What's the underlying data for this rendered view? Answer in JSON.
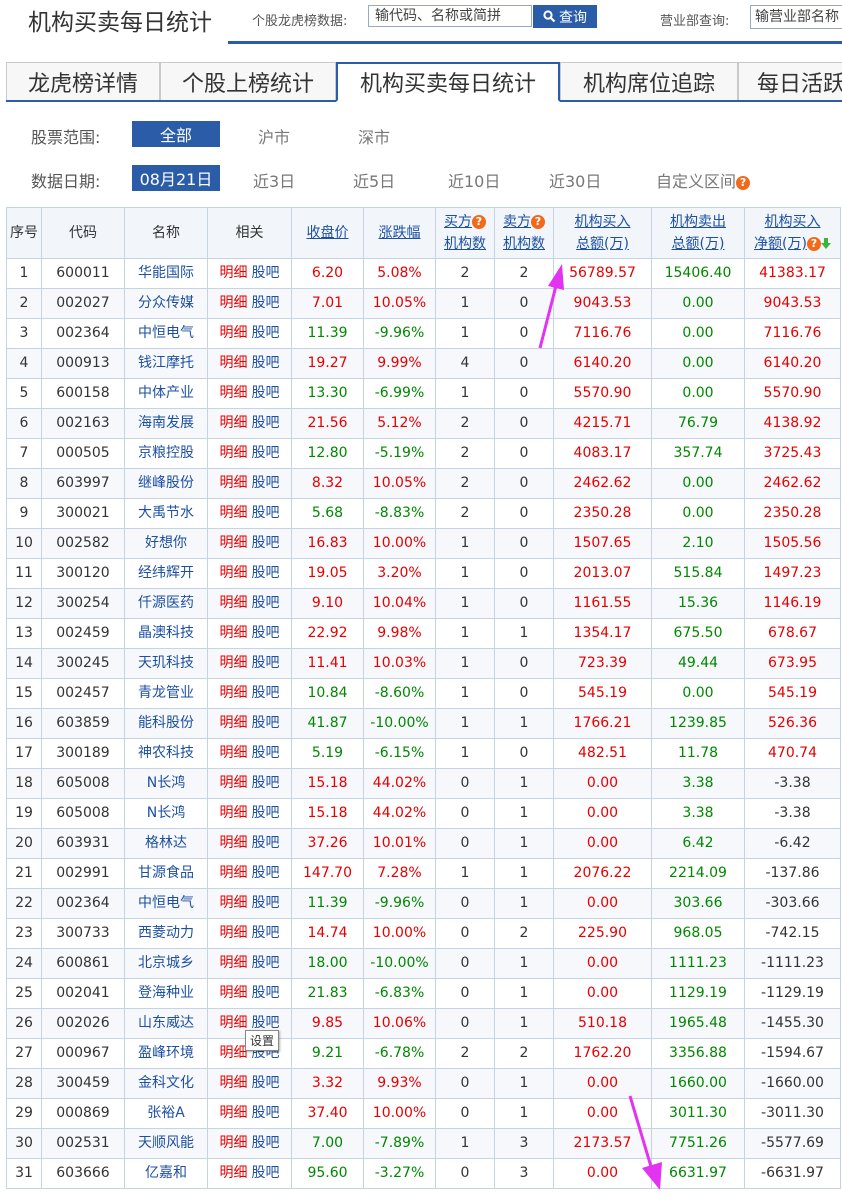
{
  "header": {
    "title": "机构买卖每日统计",
    "stock_query_label": "个股龙虎榜数据:",
    "stock_query_placeholder": "输代码、名称或简拼",
    "query_button": "查询",
    "branch_query_label": "营业部查询:",
    "branch_query_placeholder": "输营业部名称"
  },
  "tabs": [
    "龙虎榜详情",
    "个股上榜统计",
    "机构买卖每日统计",
    "机构席位追踪",
    "每日活跃"
  ],
  "filters": {
    "scope_label": "股票范围:",
    "scope_options": [
      "全部",
      "沪市",
      "深市"
    ],
    "date_label": "数据日期:",
    "date_options": [
      "08月21日",
      "近3日",
      "近5日",
      "近10日",
      "近30日",
      "自定义区间"
    ]
  },
  "table": {
    "headers": {
      "seq": "序号",
      "code": "代码",
      "name": "名称",
      "related": "相关",
      "close": "收盘价",
      "change": "涨跌幅",
      "buy_inst_1": "买方",
      "buy_inst_2": "机构数",
      "sell_inst_1": "卖方",
      "sell_inst_2": "机构数",
      "buy_total_1": "机构买入",
      "buy_total_2": "总额(万)",
      "sell_total_1": "机构卖出",
      "sell_total_2": "总额(万)",
      "net_1": "机构买入",
      "net_2": "净额(万)"
    },
    "detail_link": "明细",
    "forum_link": "股吧",
    "rows": [
      [
        "1",
        "600011",
        "华能国际",
        "6.20",
        "5.08%",
        "2",
        "2",
        "56789.57",
        "15406.40",
        "41383.17"
      ],
      [
        "2",
        "002027",
        "分众传媒",
        "7.01",
        "10.05%",
        "1",
        "0",
        "9043.53",
        "0.00",
        "9043.53"
      ],
      [
        "3",
        "002364",
        "中恒电气",
        "11.39",
        "-9.96%",
        "1",
        "0",
        "7116.76",
        "0.00",
        "7116.76"
      ],
      [
        "4",
        "000913",
        "钱江摩托",
        "19.27",
        "9.99%",
        "4",
        "0",
        "6140.20",
        "0.00",
        "6140.20"
      ],
      [
        "5",
        "600158",
        "中体产业",
        "13.30",
        "-6.99%",
        "1",
        "0",
        "5570.90",
        "0.00",
        "5570.90"
      ],
      [
        "6",
        "002163",
        "海南发展",
        "21.56",
        "5.12%",
        "2",
        "0",
        "4215.71",
        "76.79",
        "4138.92"
      ],
      [
        "7",
        "000505",
        "京粮控股",
        "12.80",
        "-5.19%",
        "2",
        "0",
        "4083.17",
        "357.74",
        "3725.43"
      ],
      [
        "8",
        "603997",
        "继峰股份",
        "8.32",
        "10.05%",
        "2",
        "0",
        "2462.62",
        "0.00",
        "2462.62"
      ],
      [
        "9",
        "300021",
        "大禹节水",
        "5.68",
        "-8.83%",
        "2",
        "0",
        "2350.28",
        "0.00",
        "2350.28"
      ],
      [
        "10",
        "002582",
        "好想你",
        "16.83",
        "10.00%",
        "1",
        "0",
        "1507.65",
        "2.10",
        "1505.56"
      ],
      [
        "11",
        "300120",
        "经纬辉开",
        "19.05",
        "3.20%",
        "1",
        "0",
        "2013.07",
        "515.84",
        "1497.23"
      ],
      [
        "12",
        "300254",
        "仟源医药",
        "9.10",
        "10.04%",
        "1",
        "0",
        "1161.55",
        "15.36",
        "1146.19"
      ],
      [
        "13",
        "002459",
        "晶澳科技",
        "22.92",
        "9.98%",
        "1",
        "1",
        "1354.17",
        "675.50",
        "678.67"
      ],
      [
        "14",
        "300245",
        "天玑科技",
        "11.41",
        "10.03%",
        "1",
        "0",
        "723.39",
        "49.44",
        "673.95"
      ],
      [
        "15",
        "002457",
        "青龙管业",
        "10.84",
        "-8.60%",
        "1",
        "0",
        "545.19",
        "0.00",
        "545.19"
      ],
      [
        "16",
        "603859",
        "能科股份",
        "41.87",
        "-10.00%",
        "1",
        "1",
        "1766.21",
        "1239.85",
        "526.36"
      ],
      [
        "17",
        "300189",
        "神农科技",
        "5.19",
        "-6.15%",
        "1",
        "0",
        "482.51",
        "11.78",
        "470.74"
      ],
      [
        "18",
        "605008",
        "N长鸿",
        "15.18",
        "44.02%",
        "0",
        "1",
        "0.00",
        "3.38",
        "-3.38"
      ],
      [
        "19",
        "605008",
        "N长鸿",
        "15.18",
        "44.02%",
        "0",
        "1",
        "0.00",
        "3.38",
        "-3.38"
      ],
      [
        "20",
        "603931",
        "格林达",
        "37.26",
        "10.01%",
        "0",
        "1",
        "0.00",
        "6.42",
        "-6.42"
      ],
      [
        "21",
        "002991",
        "甘源食品",
        "147.70",
        "7.28%",
        "1",
        "1",
        "2076.22",
        "2214.09",
        "-137.86"
      ],
      [
        "22",
        "002364",
        "中恒电气",
        "11.39",
        "-9.96%",
        "0",
        "1",
        "0.00",
        "303.66",
        "-303.66"
      ],
      [
        "23",
        "300733",
        "西菱动力",
        "14.74",
        "10.00%",
        "0",
        "2",
        "225.90",
        "968.05",
        "-742.15"
      ],
      [
        "24",
        "600861",
        "北京城乡",
        "18.00",
        "-10.00%",
        "0",
        "1",
        "0.00",
        "1111.23",
        "-1111.23"
      ],
      [
        "25",
        "002041",
        "登海种业",
        "21.83",
        "-6.83%",
        "0",
        "1",
        "0.00",
        "1129.19",
        "-1129.19"
      ],
      [
        "26",
        "002026",
        "山东威达",
        "9.85",
        "10.06%",
        "0",
        "1",
        "510.18",
        "1965.48",
        "-1455.30"
      ],
      [
        "27",
        "000967",
        "盈峰环境",
        "9.21",
        "-6.78%",
        "2",
        "2",
        "1762.20",
        "3356.88",
        "-1594.67"
      ],
      [
        "28",
        "300459",
        "金科文化",
        "3.32",
        "9.93%",
        "0",
        "1",
        "0.00",
        "1660.00",
        "-1660.00"
      ],
      [
        "29",
        "000869",
        "张裕A",
        "37.40",
        "10.00%",
        "0",
        "1",
        "0.00",
        "3011.30",
        "-3011.30"
      ],
      [
        "30",
        "002531",
        "天顺风能",
        "7.00",
        "-7.89%",
        "1",
        "3",
        "2173.57",
        "7751.26",
        "-5577.69"
      ],
      [
        "31",
        "603666",
        "亿嘉和",
        "95.60",
        "-3.27%",
        "0",
        "3",
        "0.00",
        "6631.97",
        "-6631.97"
      ]
    ]
  },
  "tooltip": "设置",
  "colors": {
    "accent": "#2a5ca8",
    "up": "#e60000",
    "down": "#008800",
    "annotation_arrow": "#e233f0",
    "help_icon": "#f06a1a"
  },
  "icons": {
    "search": "search-icon",
    "help": "question-icon",
    "sort_desc": "sort-down-icon",
    "annotation": "arrow-icon"
  }
}
